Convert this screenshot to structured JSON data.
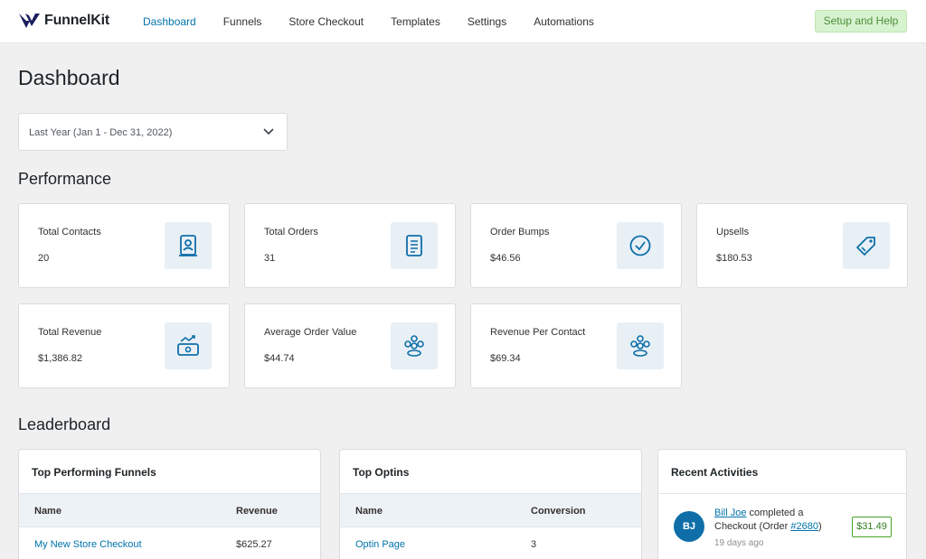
{
  "brand": {
    "name": "FunnelKit",
    "logo_icon": "funnelkit-logo"
  },
  "nav": {
    "items": [
      {
        "label": "Dashboard",
        "active": true
      },
      {
        "label": "Funnels"
      },
      {
        "label": "Store Checkout"
      },
      {
        "label": "Templates"
      },
      {
        "label": "Settings"
      },
      {
        "label": "Automations"
      }
    ],
    "setup_label": "Setup and Help"
  },
  "page_title": "Dashboard",
  "date_filter": {
    "selected": "Last Year (Jan 1 - Dec 31, 2022)",
    "icon": "chevron-down-icon"
  },
  "performance": {
    "title": "Performance",
    "cards": [
      {
        "label": "Total Contacts",
        "value": "20",
        "icon": "contact-card-icon"
      },
      {
        "label": "Total Orders",
        "value": "31",
        "icon": "receipt-icon"
      },
      {
        "label": "Order Bumps",
        "value": "$46.56",
        "icon": "check-circle-icon"
      },
      {
        "label": "Upsells",
        "value": "$180.53",
        "icon": "tag-icon"
      },
      {
        "label": "Total Revenue",
        "value": "$1,386.82",
        "icon": "revenue-icon"
      },
      {
        "label": "Average Order Value",
        "value": "$44.74",
        "icon": "coins-icon"
      },
      {
        "label": "Revenue Per Contact",
        "value": "$69.34",
        "icon": "coins-icon"
      }
    ]
  },
  "leaderboard": {
    "title": "Leaderboard",
    "top_funnels": {
      "title": "Top Performing Funnels",
      "columns": [
        "Name",
        "Revenue"
      ],
      "rows": [
        {
          "name": "My New Store Checkout",
          "revenue": "$625.27"
        }
      ]
    },
    "top_optins": {
      "title": "Top Optins",
      "columns": [
        "Name",
        "Conversion"
      ],
      "rows": [
        {
          "name": "Optin Page",
          "conversion": "3"
        }
      ]
    },
    "recent_activities": {
      "title": "Recent Activities",
      "items": [
        {
          "initials": "BJ",
          "user": "Bill Joe",
          "text_1": "completed a",
          "text_2": "Checkout (Order",
          "order": "#2680",
          "text_3": ")",
          "time": "19 days ago",
          "amount": "$31.49"
        }
      ]
    }
  },
  "colors": {
    "accent": "#0073aa",
    "setup_bg": "#d7f2cf",
    "avatar": "#0f6ea8",
    "icon_bg": "#e8f0f6"
  }
}
